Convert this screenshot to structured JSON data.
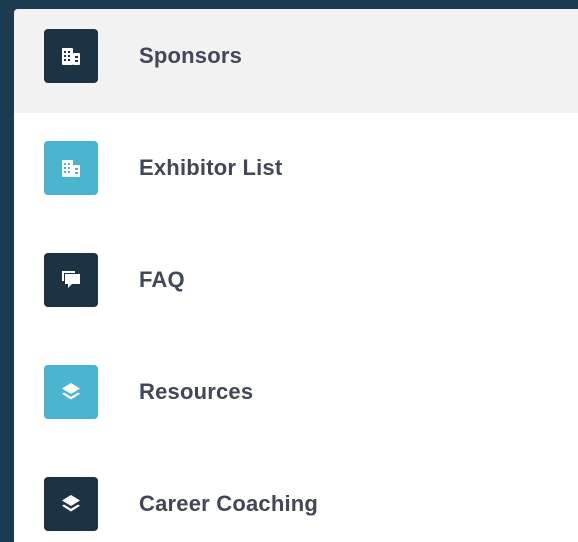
{
  "colors": {
    "background": "#1d3b4f",
    "panel": "#ffffff",
    "active_row": "#f2f2f2",
    "icon_dark": "#1d3344",
    "icon_teal": "#4bb4cf",
    "label_text": "#414658"
  },
  "menu": {
    "items": [
      {
        "label": "Sponsors",
        "icon": "building-icon",
        "icon_style": "dark",
        "active": true
      },
      {
        "label": "Exhibitor List",
        "icon": "building-icon",
        "icon_style": "teal",
        "active": false
      },
      {
        "label": "FAQ",
        "icon": "chat-bubbles-icon",
        "icon_style": "dark",
        "active": false
      },
      {
        "label": "Resources",
        "icon": "layers-icon",
        "icon_style": "teal",
        "active": false
      },
      {
        "label": "Career Coaching",
        "icon": "layers-icon",
        "icon_style": "dark",
        "active": false
      }
    ]
  }
}
